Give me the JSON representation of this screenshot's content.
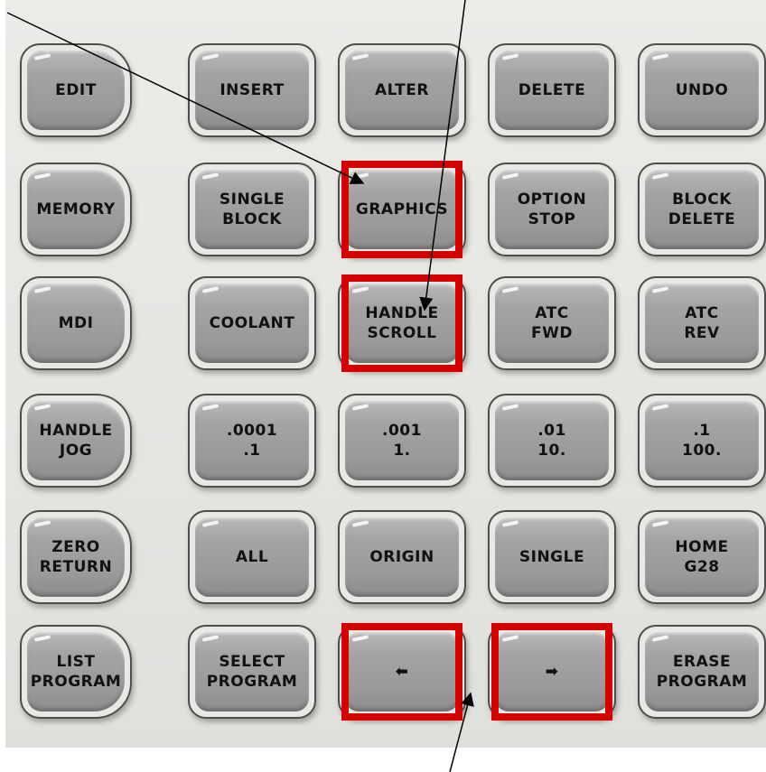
{
  "rows": [
    [
      "EDIT",
      "INSERT",
      "ALTER",
      "DELETE",
      "UNDO"
    ],
    [
      "MEMORY",
      "SINGLE\nBLOCK",
      "GRAPHICS",
      "OPTION\nSTOP",
      "BLOCK\nDELETE"
    ],
    [
      "MDI",
      "COOLANT",
      "HANDLE\nSCROLL",
      "ATC\nFWD",
      "ATC\nREV"
    ],
    [
      "HANDLE\nJOG",
      ".0001\n.1",
      ".001\n1.",
      ".01\n10.",
      ".1\n100."
    ],
    [
      "ZERO\nRETURN",
      "ALL",
      "ORIGIN",
      "SINGLE",
      "HOME\nG28"
    ],
    [
      "LIST\nPROGRAM",
      "SELECT\nPROGRAM",
      "left-arrow-icon",
      "right-arrow-icon",
      "ERASE\nPROGRAM"
    ]
  ],
  "highlight_color": "#d40000",
  "highlighted_keys": [
    "GRAPHICS",
    "HANDLE\nSCROLL",
    "left-arrow-icon",
    "right-arrow-icon"
  ],
  "arrow_icons": {
    "left": "left-arrow-icon",
    "right": "right-arrow-icon"
  }
}
